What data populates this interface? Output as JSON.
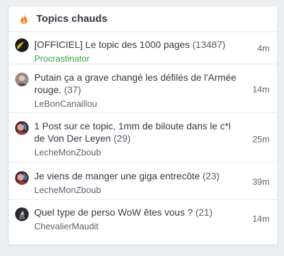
{
  "widget": {
    "title": "Topics chauds",
    "icon": "fire-icon",
    "accent_color": "#f08a3c"
  },
  "topics": [
    {
      "title": "[OFFICIEL] Le topic des 1000 pages",
      "count": "(13487)",
      "author": "Procrastinator",
      "author_color": "#3aa24a",
      "time": "4m",
      "avatar_icon": "avatar-black"
    },
    {
      "title": "Putain ça a grave changé les défilés de l'Armée rouge.",
      "count": "(37)",
      "author": "LeBonCanaillou",
      "author_color": "#5b636c",
      "time": "14m",
      "avatar_icon": "avatar-photo"
    },
    {
      "title": "1 Post sur ce topic, 1mm de biloute dans le c*l de Von Der Leyen",
      "count": "(29)",
      "author": "LecheMonZboub",
      "author_color": "#5b636c",
      "time": "25m",
      "avatar_icon": "avatar-photo"
    },
    {
      "title": "Je viens de manger une giga entrecôte",
      "count": "(23)",
      "author": "LecheMonZboub",
      "author_color": "#5b636c",
      "time": "39m",
      "avatar_icon": "avatar-photo"
    },
    {
      "title": "Quel type de perso WoW êtes vous ?",
      "count": "(21)",
      "author": "ChevalierMaudit",
      "author_color": "#5b636c",
      "time": "14m",
      "avatar_icon": "avatar-dark"
    }
  ]
}
